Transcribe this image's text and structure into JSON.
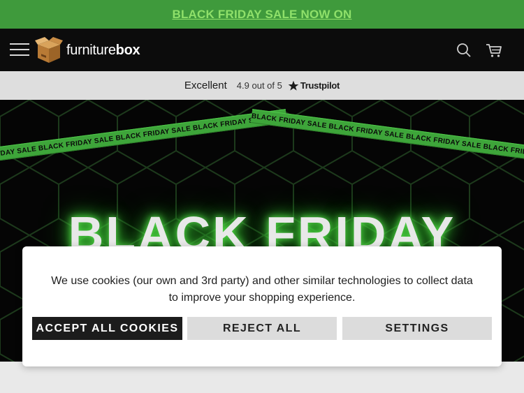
{
  "promo": {
    "text": "BLACK FRIDAY SALE NOW ON"
  },
  "header": {
    "logo_prefix": "furniture",
    "logo_suffix": "box"
  },
  "trustpilot": {
    "rating_label": "Excellent",
    "score": "4.9 out of 5",
    "brand": "Trustpilot"
  },
  "hero": {
    "headline": "BLACK FRIDAY",
    "tape_text_left": "FRIDAY SALE  BLACK FRIDAY SALE  BLACK FRIDAY SALE  BLACK FRIDAY SALE  BLACK FRIDAY",
    "tape_text_right": "BLACK FRIDAY SALE  BLACK FRIDAY SALE  BLACK FRIDAY SALE  BLACK FRIDAY SALE  BLACK"
  },
  "cookie_banner": {
    "message": "We use cookies (our own and 3rd party) and other similar technologies to collect data to improve your shopping experience.",
    "accept_label": "ACCEPT ALL COOKIES",
    "reject_label": "REJECT ALL",
    "settings_label": "SETTINGS"
  },
  "colors": {
    "promo_bg": "#3f9a3c",
    "accent_green": "#3ea53a",
    "header_bg": "#0c0c0c"
  },
  "icons": [
    "hamburger-menu-icon",
    "box-logo-icon",
    "search-icon",
    "cart-icon",
    "star-icon"
  ]
}
